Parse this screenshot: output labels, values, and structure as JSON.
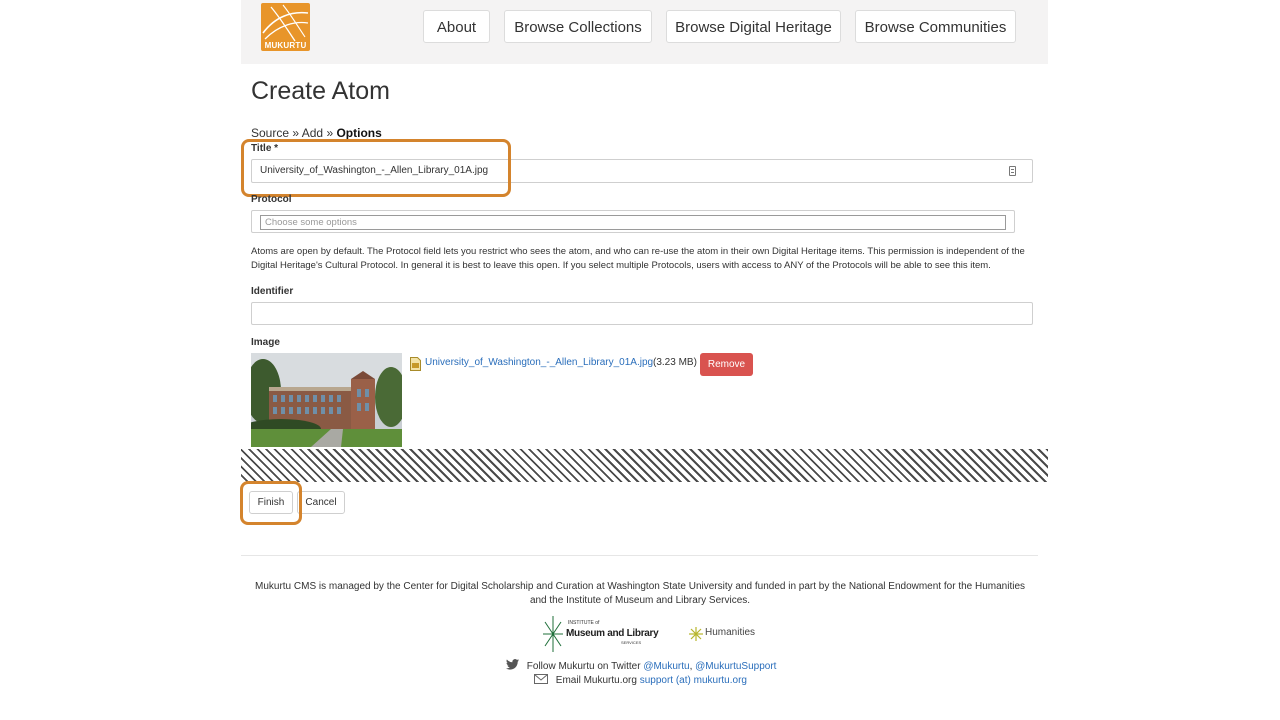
{
  "header": {
    "logo_text": "MUKURTU",
    "nav": [
      {
        "label": "About"
      },
      {
        "label": "Browse Collections"
      },
      {
        "label": "Browse Digital Heritage"
      },
      {
        "label": "Browse Communities"
      }
    ]
  },
  "page": {
    "title": "Create Atom",
    "breadcrumb": {
      "step1": "Source",
      "sep": "»",
      "step2": "Add",
      "step3": "Options"
    }
  },
  "form": {
    "title_label": "Title",
    "required_mark": "*",
    "title_value": "University_of_Washington_-_Allen_Library_01A.jpg",
    "protocol_label": "Protocol",
    "protocol_placeholder": "Choose some options",
    "protocol_help": "Atoms are open by default. The Protocol field lets you restrict who sees the atom, and who can re-use the atom in their own Digital Heritage items. This permission is independent of the Digital Heritage's Cultural Protocol. In general it is best to leave this open. If you select multiple Protocols, users with access to ANY of the Protocols will be able to see this item.",
    "identifier_label": "Identifier",
    "identifier_value": "",
    "image_label": "Image",
    "file_name": "University_of_Washington_-_Allen_Library_01A.jpg",
    "file_size": "(3.23 MB)",
    "remove_label": "Remove",
    "finish_label": "Finish",
    "cancel_label": "Cancel"
  },
  "footer": {
    "text": "Mukurtu CMS is managed by the Center for Digital Scholarship and Curation at Washington State University and funded in part by the National Endowment for the Humanities and the Institute of Museum and Library Services.",
    "imls_small": "INSTITUTE of",
    "imls_name": "Museum and Library",
    "imls_services": "SERVICES",
    "neh_name": "Humanities",
    "twitter_prefix": "Follow Mukurtu on Twitter",
    "twitter_handle1": "@Mukurtu",
    "twitter_sep": ",",
    "twitter_handle2": "@MukurtuSupport",
    "email_prefix": "Email Mukurtu.org",
    "email": "support (at) mukurtu.org"
  },
  "colors": {
    "accent_orange": "#d4842d",
    "logo_orange": "#e8952a",
    "remove_red": "#d9534f",
    "link_blue": "#2a6ebb"
  }
}
